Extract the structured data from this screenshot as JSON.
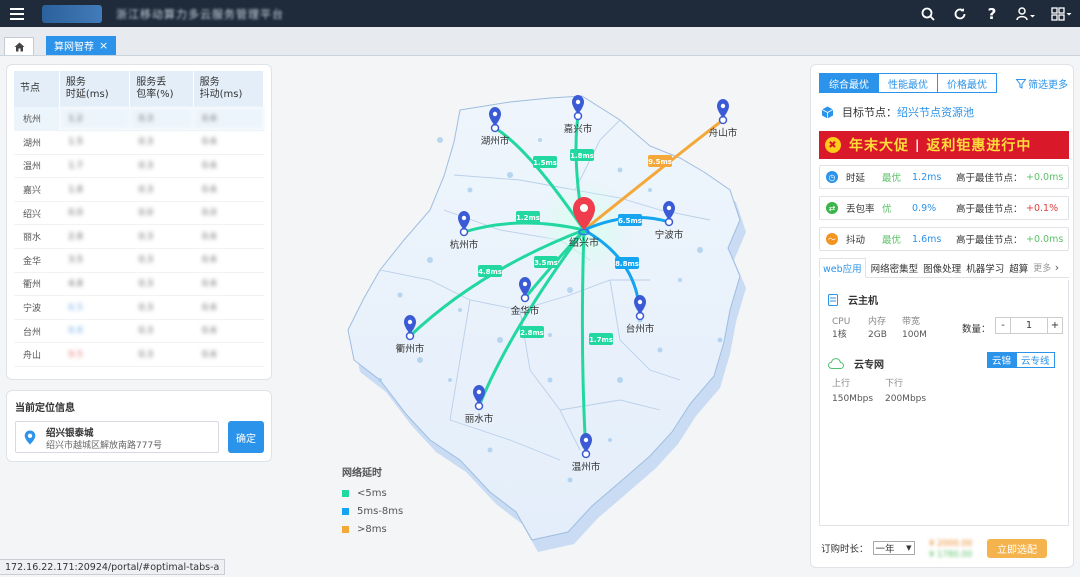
{
  "header": {
    "app_title": "浙江移动算力多云服务管理平台",
    "icons": [
      "menu-icon",
      "search-icon",
      "refresh-icon",
      "help-icon",
      "user-icon",
      "apps-grid-icon"
    ]
  },
  "tabs": {
    "home_icon": "home-icon",
    "active_label": "算网智荐",
    "close_glyph": "×"
  },
  "node_table": {
    "headers": [
      {
        "line1": "节点",
        "line2": ""
      },
      {
        "line1": "服务",
        "line2": "时延(ms)"
      },
      {
        "line1": "服务丢",
        "line2": "包率(%)"
      },
      {
        "line1": "服务",
        "line2": "抖动(ms)"
      }
    ],
    "rows": [
      {
        "node": "杭州",
        "lat": "1.2",
        "loss": "0.3",
        "jit": "0.6"
      },
      {
        "node": "湖州",
        "lat": "1.5",
        "loss": "0.3",
        "jit": "0.6"
      },
      {
        "node": "温州",
        "lat": "1.7",
        "loss": "0.3",
        "jit": "0.6"
      },
      {
        "node": "嘉兴",
        "lat": "1.8",
        "loss": "0.3",
        "jit": "0.6"
      },
      {
        "node": "绍兴",
        "lat": "0.0",
        "loss": "0.0",
        "jit": "0.0"
      },
      {
        "node": "丽水",
        "lat": "2.8",
        "loss": "0.3",
        "jit": "0.6"
      },
      {
        "node": "金华",
        "lat": "3.5",
        "loss": "0.3",
        "jit": "0.6"
      },
      {
        "node": "衢州",
        "lat": "4.8",
        "loss": "0.3",
        "jit": "0.6"
      },
      {
        "node": "宁波",
        "lat": "6.5",
        "loss": "0.3",
        "jit": "0.6"
      },
      {
        "node": "台州",
        "lat": "8.8",
        "loss": "0.3",
        "jit": "0.6"
      },
      {
        "node": "舟山",
        "lat": "9.5",
        "loss": "0.3",
        "jit": "0.6"
      }
    ]
  },
  "location": {
    "title": "当前定位信息",
    "name": "绍兴银泰城",
    "address": "绍兴市越城区解放南路777号",
    "confirm_label": "确定"
  },
  "map": {
    "center_label": "绍兴市",
    "cities": [
      {
        "name": "湖州市",
        "latency": "1.5ms",
        "tier": "fast"
      },
      {
        "name": "嘉兴市",
        "latency": "1.8ms",
        "tier": "fast"
      },
      {
        "name": "舟山市",
        "latency": "9.5ms",
        "tier": "slow"
      },
      {
        "name": "杭州市",
        "latency": "1.2ms",
        "tier": "fast"
      },
      {
        "name": "宁波市",
        "latency": "6.5ms",
        "tier": "medium"
      },
      {
        "name": "衢州市",
        "latency": "4.8ms",
        "tier": "fast"
      },
      {
        "name": "金华市",
        "latency": "3.5ms",
        "tier": "fast"
      },
      {
        "name": "台州市",
        "latency": "8.8ms",
        "tier": "medium"
      },
      {
        "name": "丽水市",
        "latency": "2.8ms",
        "tier": "fast"
      },
      {
        "name": "温州市",
        "latency": "1.7ms",
        "tier": "fast"
      }
    ],
    "colors": {
      "fast": "#22d8a0",
      "medium": "#14a4f0",
      "slow": "#f5a83a"
    }
  },
  "legend": {
    "title": "网络延时",
    "items": [
      {
        "label": "<5ms",
        "color": "#22d8a0"
      },
      {
        "label": "5ms-8ms",
        "color": "#14a4f0"
      },
      {
        "label": ">8ms",
        "color": "#f5a83a"
      }
    ]
  },
  "right_panel": {
    "opt_tabs": [
      "综合最优",
      "性能最优",
      "价格最优"
    ],
    "filter_more": "筛选更多",
    "target_label": "目标节点：",
    "target_value": "绍兴节点资源池",
    "banner": {
      "part1": "年末大促",
      "part2": "返利钜惠进行中"
    },
    "metrics": [
      {
        "name": "时延",
        "badge": "最优",
        "value": "1.2ms",
        "label": "高于最佳节点：",
        "delta": "+0.0ms",
        "color": "#2b93e9"
      },
      {
        "name": "丢包率",
        "badge": "优",
        "value": "0.9%",
        "label": "高于最佳节点：",
        "delta": "+0.1%",
        "color": "#3bb54a"
      },
      {
        "name": "抖动",
        "badge": "最优",
        "value": "1.6ms",
        "label": "高于最佳节点：",
        "delta": "+0.0ms",
        "color": "#f39322"
      }
    ],
    "service_tabs": [
      "web应用",
      "网络密集型",
      "图像处理",
      "机器学习",
      "超算"
    ],
    "service_more": "更多",
    "cloud_host": {
      "title": "云主机",
      "specs": [
        {
          "k": "CPU",
          "v": "1核"
        },
        {
          "k": "内存",
          "v": "2GB"
        },
        {
          "k": "带宽",
          "v": "100M"
        }
      ],
      "qty_label": "数量：",
      "qty_minus": "-",
      "qty_value": "1",
      "qty_plus": "+"
    },
    "cloud_net": {
      "title": "云专网",
      "modes": [
        "云锦",
        "云专线"
      ],
      "up_label": "上行",
      "up_value": "150Mbps",
      "down_label": "下行",
      "down_value": "200Mbps"
    },
    "buy": {
      "duration_label": "订购时长：",
      "duration_value": "一年",
      "price_original": "¥ 2000.00",
      "price_discount": "¥ 1780.00",
      "button": "立即选配"
    }
  },
  "status_url": "172.16.22.171:20924/portal/#optimal-tabs-a"
}
